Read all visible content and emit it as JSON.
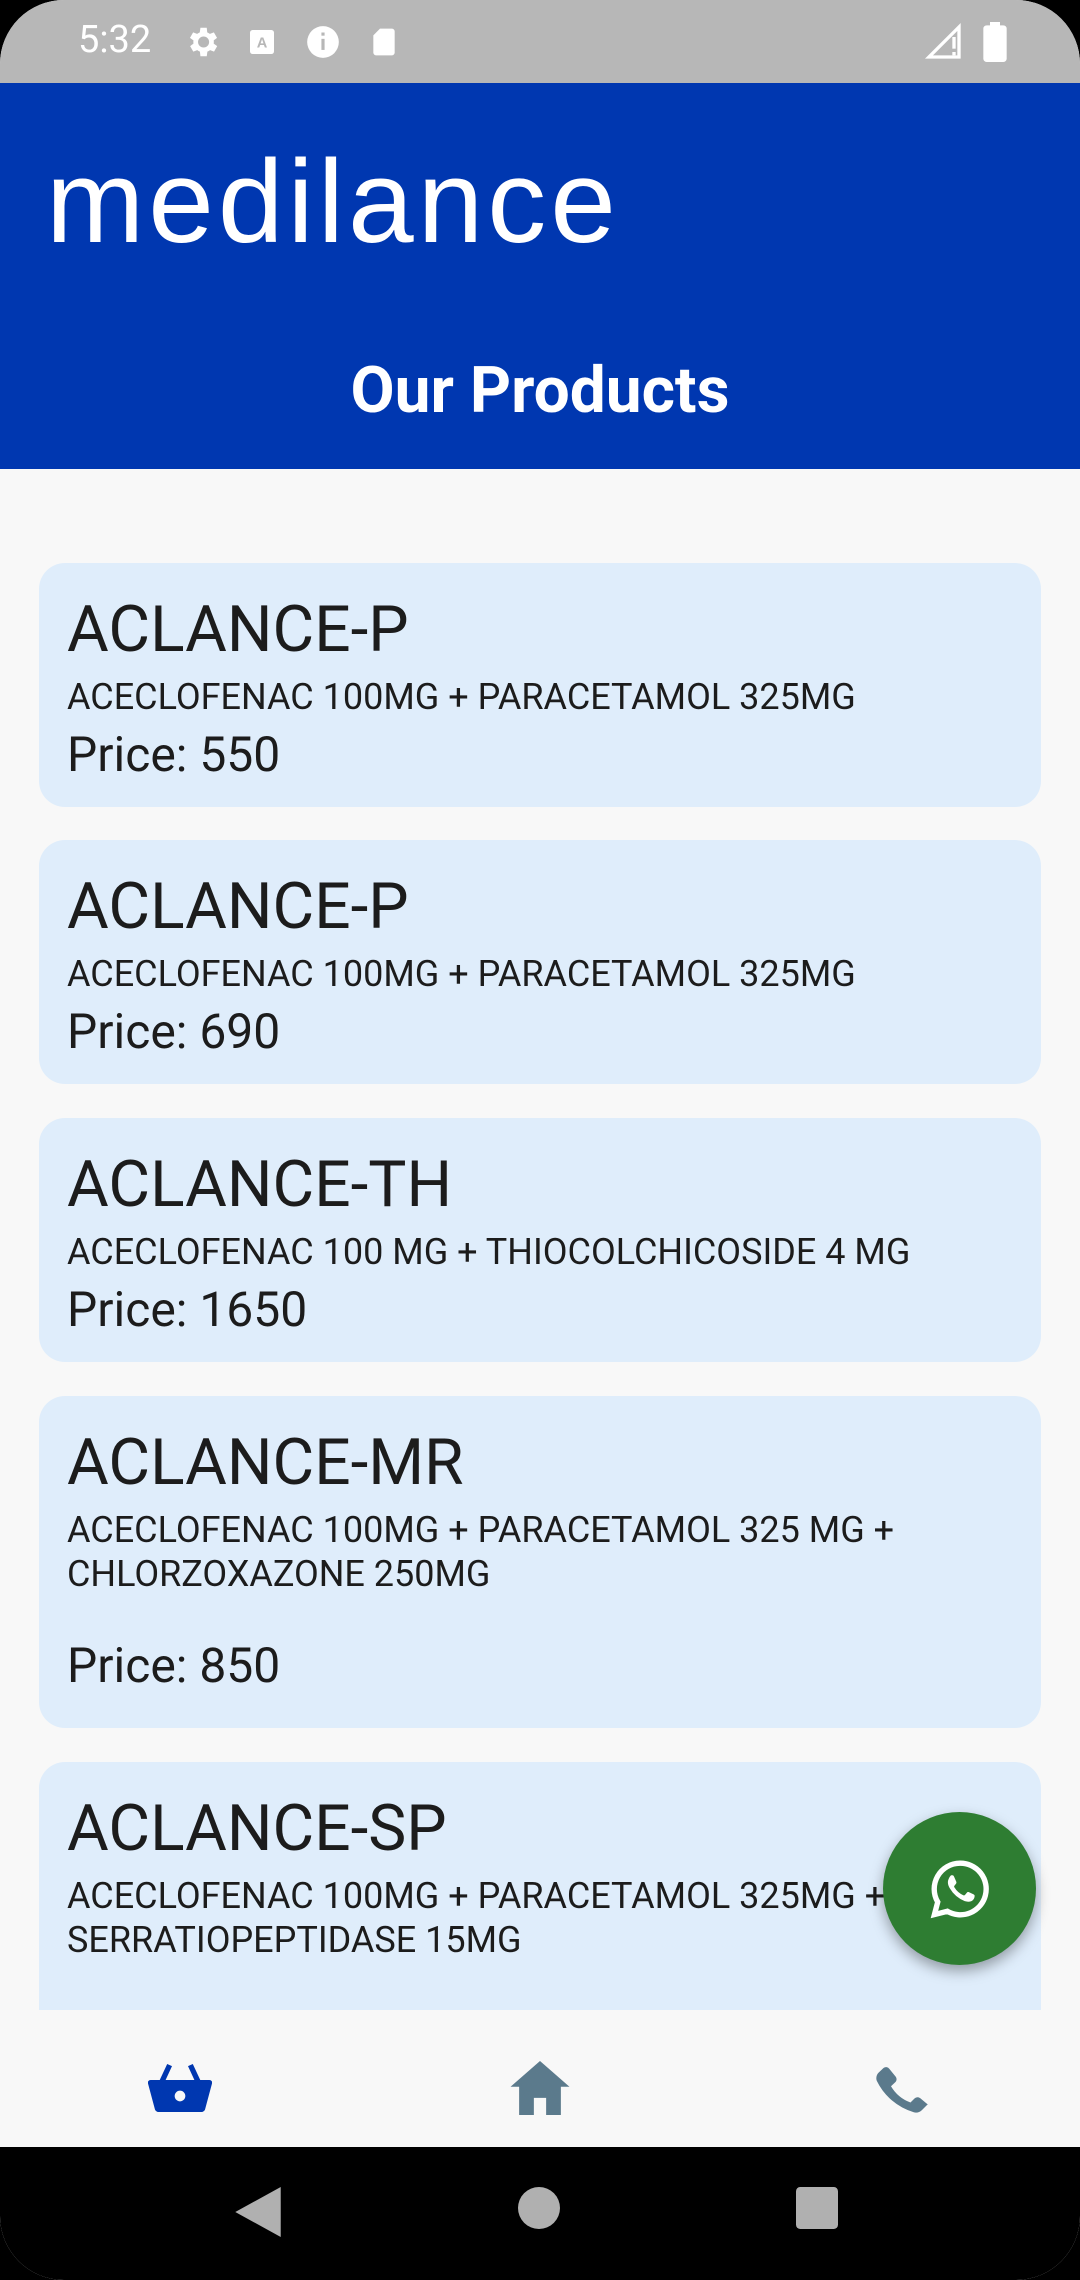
{
  "status_bar": {
    "time": "5:32",
    "icons": [
      "gear-icon",
      "font-icon",
      "info-icon",
      "sd-card-icon",
      "signal-icon",
      "battery-icon"
    ]
  },
  "header": {
    "logo_text": "medilance",
    "title": "Our Products",
    "background_color": "#0037b0"
  },
  "products": [
    {
      "name": "ACLANCE-P",
      "composition": "ACECLOFENAC 100MG + PARACETAMOL 325MG",
      "price": "Price: 550"
    },
    {
      "name": "ACLANCE-P",
      "composition": "ACECLOFENAC 100MG + PARACETAMOL 325MG",
      "price": "Price: 690"
    },
    {
      "name": "ACLANCE-TH",
      "composition": "ACECLOFENAC 100 MG + THIOCOLCHICOSIDE 4 MG",
      "price": "Price: 1650"
    },
    {
      "name": "ACLANCE-MR",
      "composition": "ACECLOFENAC 100MG + PARACETAMOL 325 MG + CHLORZOXAZONE 250MG",
      "price": "Price: 850"
    },
    {
      "name": "ACLANCE-SP",
      "composition": "ACECLOFENAC 100MG + PARACETAMOL 325MG + SERRATIOPEPTIDASE 15MG",
      "price": ""
    }
  ],
  "fab": {
    "icon": "whatsapp-icon",
    "color": "#2e7d32"
  },
  "bottom_nav": {
    "items": [
      {
        "icon": "basket-icon",
        "active": true,
        "color": "#0037b0"
      },
      {
        "icon": "home-icon",
        "active": false,
        "color": "#5b7a8c"
      },
      {
        "icon": "phone-icon",
        "active": false,
        "color": "#5b7a8c"
      }
    ]
  },
  "system_nav": [
    "back-icon",
    "home-circle-icon",
    "recents-icon"
  ]
}
